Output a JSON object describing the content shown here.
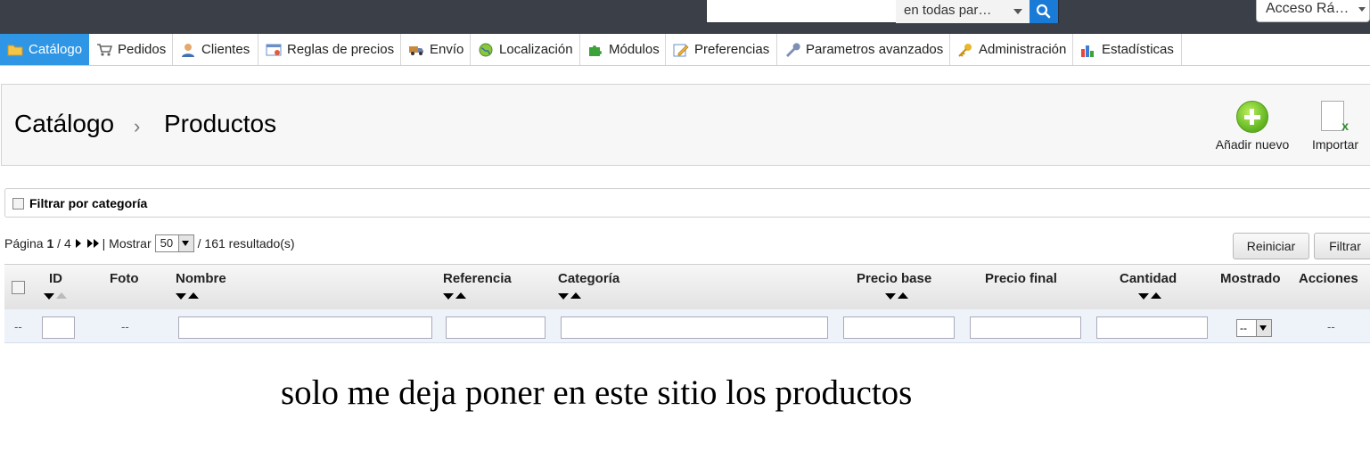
{
  "search": {
    "scope": "en todas par…"
  },
  "quick_access": "Acceso Rá…",
  "menu": [
    {
      "label": "Catálogo",
      "icon": "folder-icon",
      "active": true
    },
    {
      "label": "Pedidos",
      "icon": "cart-icon"
    },
    {
      "label": "Clientes",
      "icon": "user-icon"
    },
    {
      "label": "Reglas de precios",
      "icon": "price-tag-icon"
    },
    {
      "label": "Envío",
      "icon": "truck-icon"
    },
    {
      "label": "Localización",
      "icon": "globe-icon"
    },
    {
      "label": "Módulos",
      "icon": "puzzle-icon"
    },
    {
      "label": "Preferencias",
      "icon": "pencil-form-icon"
    },
    {
      "label": "Parametros avanzados",
      "icon": "wrench-icon"
    },
    {
      "label": "Administración",
      "icon": "key-icon"
    },
    {
      "label": "Estadísticas",
      "icon": "bar-chart-icon"
    }
  ],
  "header": {
    "breadcrumb_parent": "Catálogo",
    "breadcrumb_sep": "›",
    "breadcrumb_current": "Productos",
    "add_new_label": "Añadir nuevo",
    "import_label": "Importar"
  },
  "category_filter": {
    "label": "Filtrar por categoría"
  },
  "pagination": {
    "page_label": "Página",
    "current_page": "1",
    "total_pages": "/ 4",
    "show_label": "| Mostrar",
    "per_page": "50",
    "results": "/ 161 resultado(s)"
  },
  "buttons": {
    "reset": "Reiniciar",
    "filter": "Filtrar"
  },
  "table": {
    "columns": [
      "ID",
      "Foto",
      "Nombre",
      "Referencia",
      "Categoría",
      "Precio base",
      "Precio final",
      "Cantidad",
      "Mostrado",
      "Acciones"
    ],
    "filter_dash": "--",
    "shown_value": "--"
  },
  "caption": "solo me deja poner en este sitio los productos",
  "colors": {
    "topbar": "#3b4048",
    "active_tab": "#2f96e6",
    "search_button": "#1a7bd6"
  }
}
